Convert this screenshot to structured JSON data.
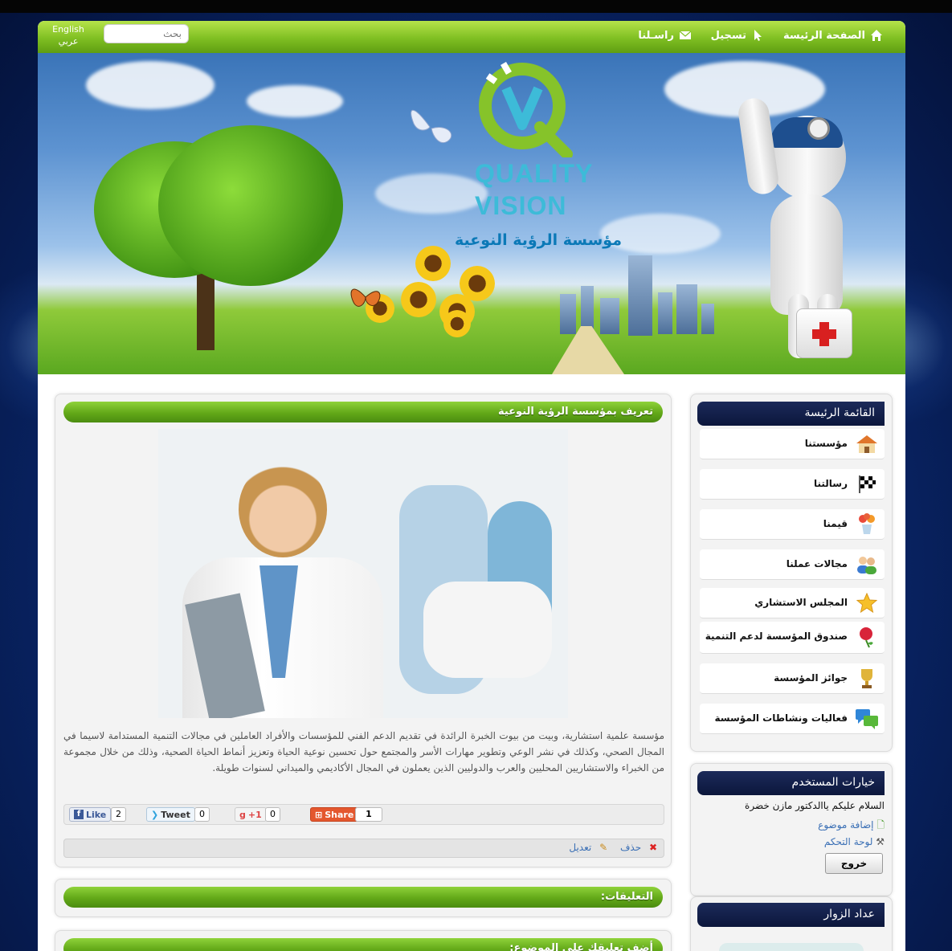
{
  "nav": {
    "home": "الصفحة الرئيسة",
    "register": "تسجيل",
    "contact": "راسـلنا",
    "search_placeholder": "بحث",
    "lang_en": "English",
    "lang_ar": "عربي"
  },
  "banner": {
    "brand_line1": "QUALITY",
    "brand_line2": "VISION",
    "brand_ar": "مؤسسة الرؤية النوعية"
  },
  "article": {
    "title": "تعريف بمؤسسة الرؤية النوعية",
    "body": "مؤسسة علمية استشارية، وبيت من بيوت الخبرة الرائدة في تقديم الدعم الفني للمؤسسات والأفراد العاملين في مجالات التنمية المستدامة لاسيما في المجال الصحي، وكذلك في نشر الوعي وتطوير مهارات الأسر والمجتمع حول تحسين نوعية الحياة وتعزيز أنماط الحياة الصحية، وذلك من خلال مجموعة من الخبراء والاستشاريين المحليين والعرب والدوليين الذين يعملون في المجال الأكاديمي والميداني لسنوات طويلة.",
    "social": {
      "like_label": "Like",
      "like_count": "2",
      "tweet_label": "Tweet",
      "tweet_count": "0",
      "gplus_label": "+1",
      "gplus_count": "0",
      "share_label": "Share",
      "share_count": "1"
    },
    "delete_label": "حذف",
    "edit_label": "تعديل"
  },
  "comments": {
    "title": "التعليقات:",
    "add_title": "أضف تعليقك على الموضوع:"
  },
  "sidebar": {
    "menu_title": "القائمة الرئيسة",
    "items": [
      {
        "label": "مؤسستنا",
        "icon": "house-icon"
      },
      {
        "label": "رسالتنا",
        "icon": "checkered-flag-icon"
      },
      {
        "label": "قيمنا",
        "icon": "flower-vase-icon"
      },
      {
        "label": "مجالات عملنا",
        "icon": "users-icon"
      },
      {
        "label": "المجلس الاستشاري",
        "icon": "star-icon"
      },
      {
        "label": "صندوق المؤسسة لدعم التنمية",
        "icon": "rose-icon"
      },
      {
        "label": "جوائز المؤسسة",
        "icon": "trophy-icon"
      },
      {
        "label": "فعاليات ونشاطات المؤسسة",
        "icon": "chat-bubbles-icon"
      }
    ],
    "user_title": "خيارات المستخدم",
    "greeting": "السلام عليكم ياالدكتور مازن خضرة",
    "add_topic": "إضافة موضوع",
    "control_panel": "لوحة التحكم",
    "logout": "خروج",
    "visitors_title": "عداد الزوار"
  },
  "colors": {
    "nav_green": "#7fbf22",
    "sidebar_navy": "#0b163b",
    "link_blue": "#3a6fb5"
  }
}
